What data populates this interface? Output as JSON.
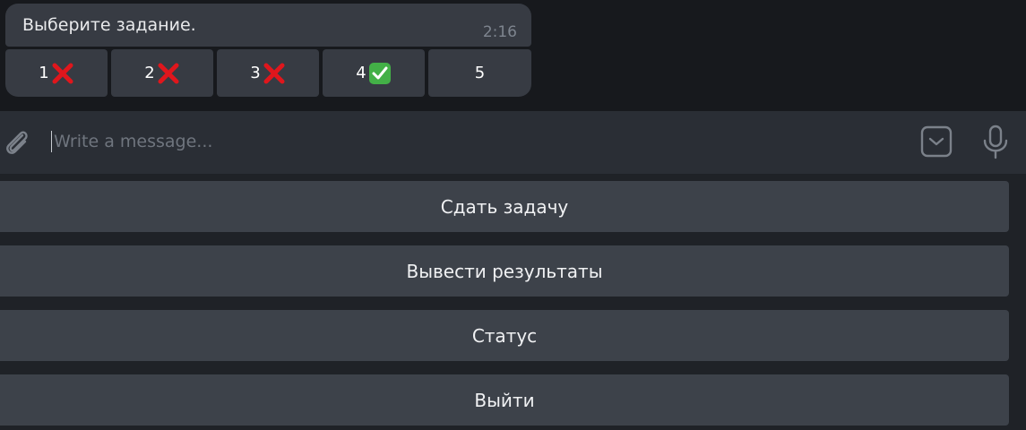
{
  "message": {
    "text": "Выберите задание.",
    "time": "2:16"
  },
  "inline_keyboard": [
    {
      "label": "1",
      "mark": "cross"
    },
    {
      "label": "2",
      "mark": "cross"
    },
    {
      "label": "3",
      "mark": "cross"
    },
    {
      "label": "4",
      "mark": "check"
    },
    {
      "label": "5",
      "mark": "none"
    }
  ],
  "composer": {
    "placeholder": "Write a message...",
    "icons": [
      "paperclip-icon",
      "keyboard-toggle-icon",
      "microphone-icon"
    ]
  },
  "reply_keyboard": [
    {
      "label": "Сдать задачу"
    },
    {
      "label": "Вывести результаты"
    },
    {
      "label": "Статус"
    },
    {
      "label": "Выйти"
    }
  ],
  "colors": {
    "background": "#17191d",
    "bubble": "#373b43",
    "composer": "#2a2e35",
    "reply_button": "#3d424a",
    "cross": "#e0161c",
    "check": "#43b047"
  }
}
